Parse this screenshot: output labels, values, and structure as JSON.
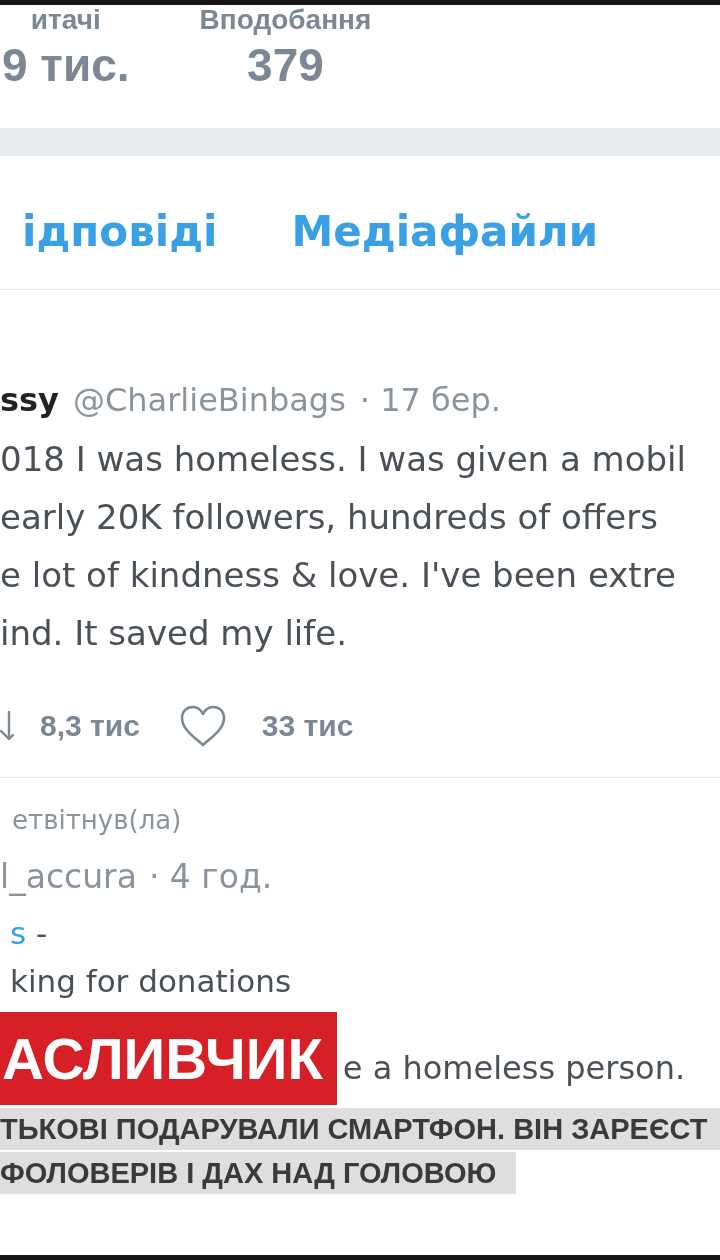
{
  "profile_stats": [
    {
      "label": "итачі",
      "value": "9 тис."
    },
    {
      "label": "Вподобання",
      "value": "379"
    }
  ],
  "tabs": [
    {
      "label": "ідповіді",
      "selected": false
    },
    {
      "label": "Медіафайли",
      "selected": false
    }
  ],
  "tweet": {
    "name": "ssy",
    "handle": "@CharlieBinbags",
    "time": "· 17 бер.",
    "text_lines": [
      "018 I was homeless. I was given a mobil",
      "early 20K followers, hundreds of offers",
      "e lot of kindness & love. I've been extre",
      "ind. It saved my life."
    ],
    "actions": [
      {
        "kind": "retweet",
        "count": "8,3 тис"
      },
      {
        "kind": "like",
        "count": "33 тис"
      }
    ]
  },
  "retweet": {
    "context": "етвітнув(ла)",
    "handle": "l_accura",
    "time": "· 4 год.",
    "mention": "s",
    "mention_suffix": "-",
    "text_lines": [
      "king for donations",
      "e a homeless person."
    ]
  },
  "news_overlay": {
    "headline": "АСЛИВЧИК",
    "subtitle_lines": [
      "ТЬКОВІ ПОДАРУВАЛИ СМАРТФОН. ВІН ЗАРЕЄСТ",
      "ФОЛОВЕРІВ І ДАХ НАД ГОЛОВОЮ"
    ]
  }
}
